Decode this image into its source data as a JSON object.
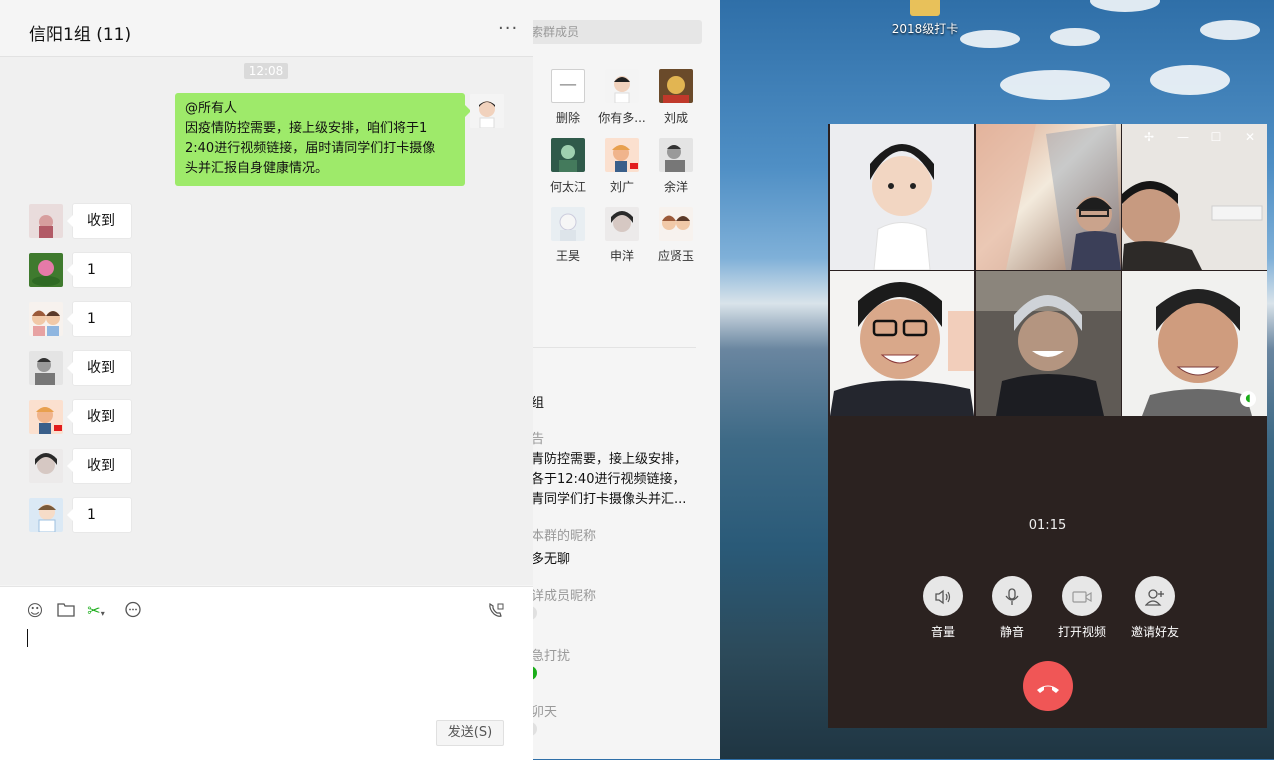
{
  "chat": {
    "title": "信阳1组 (11)",
    "more": "···",
    "time": "12:08",
    "my_message": {
      "line1": "@所有人",
      "line2": "因疫情防控需要，接上级安排，咱们将于1",
      "line3": "2:40进行视频链接，届时请同学们打卡摄像",
      "line4": "头并汇报自身健康情况。"
    },
    "replies": [
      "收到",
      "1",
      "1",
      "收到",
      "收到",
      "收到",
      "1"
    ],
    "toolbar": {
      "emoji_icon": "emoji-icon",
      "folder_icon": "folder-icon",
      "scissors_icon": "scissors-icon",
      "chat_history_icon": "chat-bubble-icon",
      "video_call_icon": "video-call-icon"
    },
    "send_label": "发送(S)"
  },
  "group_panel": {
    "search_placeholder": "索群成员",
    "members": [
      {
        "name": "删除"
      },
      {
        "name": "你有多..."
      },
      {
        "name": "刘成"
      },
      {
        "name": "何太江"
      },
      {
        "name": "刘广"
      },
      {
        "name": "余洋"
      },
      {
        "name": "王昊"
      },
      {
        "name": "申洋"
      },
      {
        "name": "应贤玉"
      }
    ],
    "group_name_value": "组",
    "announcement_label": "告",
    "announcement_lines": [
      "青防控需要，接上级安排，",
      "各于12:40进行视频链接，",
      "青同学们打卡摄像头并汇..."
    ],
    "my_nick_label": "本群的昵称",
    "my_nick_value": "多无聊",
    "show_nick_label": "详成员昵称",
    "dnd_label": "急打扰",
    "pin_label": "卯天"
  },
  "desktop": {
    "folder_label": "2018级打卡"
  },
  "call": {
    "timer": "01:15",
    "controls": [
      {
        "label": "音量",
        "icon": "speaker-icon"
      },
      {
        "label": "静音",
        "icon": "microphone-icon"
      },
      {
        "label": "打开视频",
        "icon": "video-camera-icon"
      },
      {
        "label": "邀请好友",
        "icon": "add-person-icon"
      }
    ],
    "hangup_icon": "hang-up-icon"
  },
  "colors": {
    "my_bubble": "#9eea6a",
    "hangup": "#f05656",
    "toggle_on": "#1aad19"
  }
}
